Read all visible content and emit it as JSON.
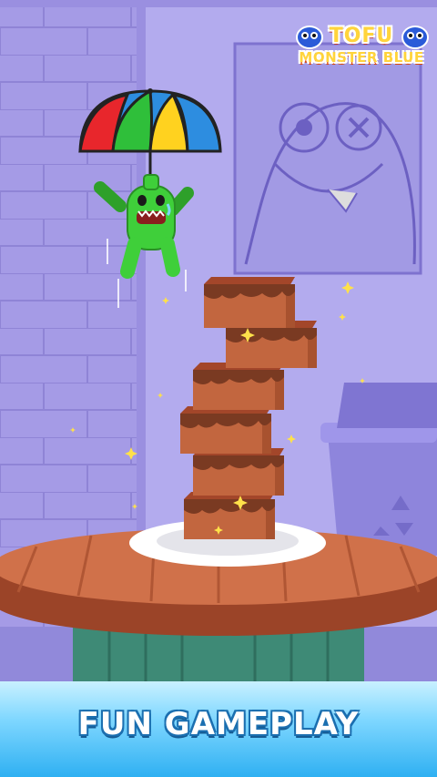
{
  "logo": {
    "line1": "TOFU",
    "line2": "MONSTER BLUE",
    "mascot_left_icon": "blue-monster-face",
    "mascot_right_icon": "blue-monster-face"
  },
  "banner": {
    "title": "FUN GAMEPLAY"
  },
  "scene": {
    "umbrella_colors": [
      "#e8262c",
      "#2d8de0",
      "#2fbf3a",
      "#ffd21f",
      "#e8262c"
    ],
    "tofu_block_count": 6,
    "character_color": "#3fcf3a",
    "wall_color": "#a59be6",
    "table_color": "#c9623e",
    "icons": [
      "umbrella",
      "green-monster",
      "tofu-block",
      "plate",
      "table",
      "trash-bin",
      "recycle-icon",
      "sparkle-star",
      "monster-poster"
    ]
  }
}
